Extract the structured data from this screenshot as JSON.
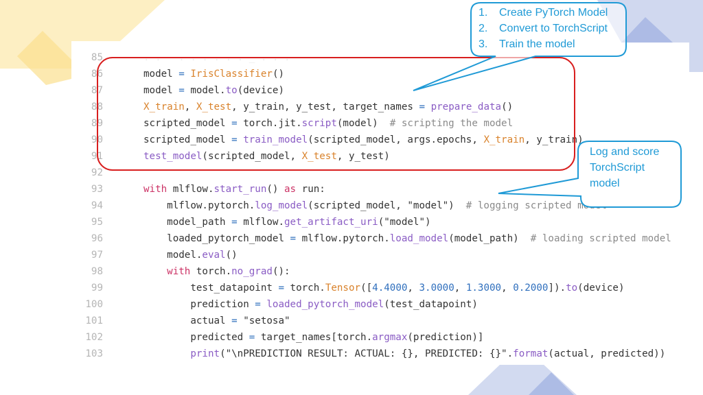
{
  "slide": {
    "accent_colors": {
      "highlight_box": "#d81e1e",
      "callout": "#1f9ad6",
      "yellow_deco": "#fbe6a6",
      "blue_deco": "#c5cfe9"
    }
  },
  "code_editor": {
    "lines": [
      {
        "num": "85",
        "tokens": []
      },
      {
        "num": "86",
        "tokens": [
          {
            "t": "model ",
            "c": ""
          },
          {
            "t": "=",
            "c": "op"
          },
          {
            "t": " ",
            "c": ""
          },
          {
            "t": "IrisClassifier",
            "c": "cls"
          },
          {
            "t": "()",
            "c": ""
          }
        ]
      },
      {
        "num": "87",
        "tokens": [
          {
            "t": "model ",
            "c": ""
          },
          {
            "t": "=",
            "c": "op"
          },
          {
            "t": " model.",
            "c": ""
          },
          {
            "t": "to",
            "c": "fn"
          },
          {
            "t": "(device)",
            "c": ""
          }
        ]
      },
      {
        "num": "88",
        "tokens": [
          {
            "t": "X_train",
            "c": "var"
          },
          {
            "t": ", ",
            "c": ""
          },
          {
            "t": "X_test",
            "c": "var"
          },
          {
            "t": ", y_train, y_test, target_names ",
            "c": ""
          },
          {
            "t": "=",
            "c": "op"
          },
          {
            "t": " ",
            "c": ""
          },
          {
            "t": "prepare_data",
            "c": "fn"
          },
          {
            "t": "()",
            "c": ""
          }
        ]
      },
      {
        "num": "89",
        "tokens": [
          {
            "t": "scripted_model ",
            "c": ""
          },
          {
            "t": "=",
            "c": "op"
          },
          {
            "t": " torch.jit.",
            "c": ""
          },
          {
            "t": "script",
            "c": "fn"
          },
          {
            "t": "(model)  ",
            "c": ""
          },
          {
            "t": "# scripting the model",
            "c": "cm"
          }
        ]
      },
      {
        "num": "90",
        "tokens": [
          {
            "t": "scripted_model ",
            "c": ""
          },
          {
            "t": "=",
            "c": "op"
          },
          {
            "t": " ",
            "c": ""
          },
          {
            "t": "train_model",
            "c": "fn"
          },
          {
            "t": "(scripted_model, args.epochs, ",
            "c": ""
          },
          {
            "t": "X_train",
            "c": "var"
          },
          {
            "t": ", y_train)",
            "c": ""
          }
        ]
      },
      {
        "num": "91",
        "tokens": [
          {
            "t": "test_model",
            "c": "fn"
          },
          {
            "t": "(scripted_model, ",
            "c": ""
          },
          {
            "t": "X_test",
            "c": "var"
          },
          {
            "t": ", y_test)",
            "c": ""
          }
        ]
      },
      {
        "num": "92",
        "tokens": []
      },
      {
        "num": "93",
        "tokens": [
          {
            "t": "with",
            "c": "kw"
          },
          {
            "t": " mlflow.",
            "c": ""
          },
          {
            "t": "start_run",
            "c": "fn"
          },
          {
            "t": "() ",
            "c": ""
          },
          {
            "t": "as",
            "c": "kw"
          },
          {
            "t": " run:",
            "c": ""
          }
        ]
      },
      {
        "num": "94",
        "tokens": [
          {
            "t": "    mlflow.pytorch.",
            "c": ""
          },
          {
            "t": "log_model",
            "c": "fn"
          },
          {
            "t": "(scripted_model, \"model\")  ",
            "c": ""
          },
          {
            "t": "# logging scripted model",
            "c": "cm"
          }
        ]
      },
      {
        "num": "95",
        "tokens": [
          {
            "t": "    model_path ",
            "c": ""
          },
          {
            "t": "=",
            "c": "op"
          },
          {
            "t": " mlflow.",
            "c": ""
          },
          {
            "t": "get_artifact_uri",
            "c": "fn"
          },
          {
            "t": "(\"model\")",
            "c": ""
          }
        ]
      },
      {
        "num": "96",
        "tokens": [
          {
            "t": "    loaded_pytorch_model ",
            "c": ""
          },
          {
            "t": "=",
            "c": "op"
          },
          {
            "t": " mlflow.pytorch.",
            "c": ""
          },
          {
            "t": "load_model",
            "c": "fn"
          },
          {
            "t": "(model_path)  ",
            "c": ""
          },
          {
            "t": "# loading scripted model",
            "c": "cm"
          }
        ]
      },
      {
        "num": "97",
        "tokens": [
          {
            "t": "    model.",
            "c": ""
          },
          {
            "t": "eval",
            "c": "fn"
          },
          {
            "t": "()",
            "c": ""
          }
        ]
      },
      {
        "num": "98",
        "tokens": [
          {
            "t": "    ",
            "c": ""
          },
          {
            "t": "with",
            "c": "kw"
          },
          {
            "t": " torch.",
            "c": ""
          },
          {
            "t": "no_grad",
            "c": "fn"
          },
          {
            "t": "():",
            "c": ""
          }
        ]
      },
      {
        "num": "99",
        "tokens": [
          {
            "t": "        test_datapoint ",
            "c": ""
          },
          {
            "t": "=",
            "c": "op"
          },
          {
            "t": " torch.",
            "c": ""
          },
          {
            "t": "Tensor",
            "c": "cls"
          },
          {
            "t": "([",
            "c": ""
          },
          {
            "t": "4.4000",
            "c": "num"
          },
          {
            "t": ", ",
            "c": ""
          },
          {
            "t": "3.0000",
            "c": "num"
          },
          {
            "t": ", ",
            "c": ""
          },
          {
            "t": "1.3000",
            "c": "num"
          },
          {
            "t": ", ",
            "c": ""
          },
          {
            "t": "0.2000",
            "c": "num"
          },
          {
            "t": "]).",
            "c": ""
          },
          {
            "t": "to",
            "c": "fn"
          },
          {
            "t": "(device)",
            "c": ""
          }
        ]
      },
      {
        "num": "100",
        "tokens": [
          {
            "t": "        prediction ",
            "c": ""
          },
          {
            "t": "=",
            "c": "op"
          },
          {
            "t": " ",
            "c": ""
          },
          {
            "t": "loaded_pytorch_model",
            "c": "fn"
          },
          {
            "t": "(test_datapoint)",
            "c": ""
          }
        ]
      },
      {
        "num": "101",
        "tokens": [
          {
            "t": "        actual ",
            "c": ""
          },
          {
            "t": "=",
            "c": "op"
          },
          {
            "t": " \"setosa\"",
            "c": ""
          }
        ]
      },
      {
        "num": "102",
        "tokens": [
          {
            "t": "        predicted ",
            "c": ""
          },
          {
            "t": "=",
            "c": "op"
          },
          {
            "t": " target_names[torch.",
            "c": ""
          },
          {
            "t": "argmax",
            "c": "fn"
          },
          {
            "t": "(prediction)]",
            "c": ""
          }
        ]
      },
      {
        "num": "103",
        "tokens": [
          {
            "t": "        ",
            "c": ""
          },
          {
            "t": "print",
            "c": "fn"
          },
          {
            "t": "(\"\\nPREDICTION RESULT: ACTUAL: {}, PREDICTED: {}\".",
            "c": ""
          },
          {
            "t": "format",
            "c": "fn"
          },
          {
            "t": "(actual, predicted))",
            "c": ""
          }
        ]
      }
    ]
  },
  "callouts": {
    "steps": {
      "items": [
        {
          "num": "1.",
          "label": "Create PyTorch Model"
        },
        {
          "num": "2.",
          "label": "Convert to TorchScript"
        },
        {
          "num": "3.",
          "label": "Train the model"
        }
      ]
    },
    "log_score": {
      "lines": [
        "Log and score",
        "TorchScript",
        "model"
      ]
    }
  }
}
